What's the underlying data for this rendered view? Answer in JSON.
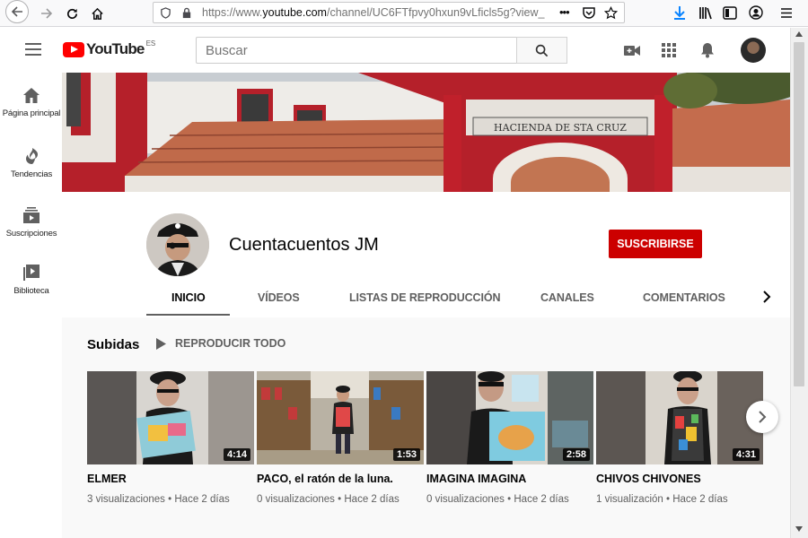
{
  "browser": {
    "url_prefix": "https://www.",
    "url_host": "youtube.com",
    "url_path": "/channel/UC6FTfpvy0hxun9vLficls5g?view_",
    "url_more": "•••"
  },
  "header": {
    "logo_text": "YouTube",
    "logo_country": "ES",
    "search_placeholder": "Buscar"
  },
  "sidebar": {
    "items": [
      {
        "label": "Página principal",
        "icon": "home-icon"
      },
      {
        "label": "Tendencias",
        "icon": "flame-icon"
      },
      {
        "label": "Suscripciones",
        "icon": "subscriptions-icon"
      },
      {
        "label": "Biblioteca",
        "icon": "library-icon"
      }
    ]
  },
  "banner": {
    "sign_text": "HACIENDA DE STA CRUZ"
  },
  "channel": {
    "name": "Cuentacuentos JM",
    "subscribe_label": "SUSCRIBIRSE",
    "tabs": [
      {
        "label": "INICIO",
        "active": true
      },
      {
        "label": "VÍDEOS",
        "active": false
      },
      {
        "label": "LISTAS DE REPRODUCCIÓN",
        "active": false
      },
      {
        "label": "CANALES",
        "active": false
      },
      {
        "label": "COMENTARIOS",
        "active": false
      }
    ]
  },
  "shelf": {
    "title": "Subidas",
    "play_all_label": "REPRODUCIR TODO",
    "videos": [
      {
        "title": "ELMER",
        "duration": "4:14",
        "views": "3 visualizaciones",
        "age": "Hace 2 días"
      },
      {
        "title": "PACO, el ratón de la luna.",
        "duration": "1:53",
        "views": "0 visualizaciones",
        "age": "Hace 2 días"
      },
      {
        "title": "IMAGINA IMAGINA",
        "duration": "2:58",
        "views": "0 visualizaciones",
        "age": "Hace 2 días"
      },
      {
        "title": "CHIVOS CHIVONES",
        "duration": "4:31",
        "views": "1 visualización",
        "age": "Hace 2 días"
      }
    ],
    "meta_separator": "•"
  },
  "colors": {
    "brand_red": "#ff0000",
    "subscribe_red": "#cc0000",
    "content_bg": "#f9f9f9"
  }
}
